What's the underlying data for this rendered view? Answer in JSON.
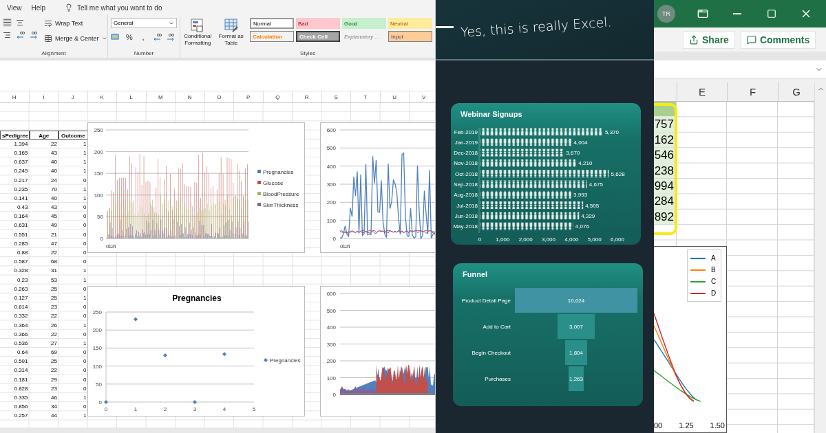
{
  "excel_left": {
    "menu": [
      {
        "label": "View"
      },
      {
        "label": "Help"
      }
    ],
    "tell_me": "Tell me what you want to do",
    "alignment": {
      "wrap_text": "Wrap Text",
      "merge": "Merge & Center",
      "label": "Alignment"
    },
    "number": {
      "format": "General",
      "percent": "%",
      "comma": ",",
      "label": "Number"
    },
    "styles": {
      "conditional": [
        "Conditional",
        "Formatting"
      ],
      "format_table": [
        "Format as",
        "Table"
      ],
      "label": "Styles",
      "cells": [
        {
          "label": "Normal",
          "kind": "normal"
        },
        {
          "label": "Bad",
          "kind": "bad"
        },
        {
          "label": "Good",
          "kind": "good"
        },
        {
          "label": "Neutral",
          "kind": "neutral"
        },
        {
          "label": "Calculation",
          "kind": "calculation"
        },
        {
          "label": "Check Cell",
          "kind": "check"
        },
        {
          "label": "Explanatory ...",
          "kind": "explanatory"
        },
        {
          "label": "Input",
          "kind": "input"
        }
      ]
    },
    "columns": [
      "H",
      "I",
      "J",
      "K",
      "L",
      "M",
      "N",
      "O",
      "P",
      "Q",
      "R",
      "S",
      "T",
      "U",
      "V"
    ],
    "table": {
      "columns": [
        "sPedigree",
        "Age",
        "Outcome"
      ],
      "rows": [
        [
          "1.394",
          "22",
          "1"
        ],
        [
          "0.165",
          "43",
          "1"
        ],
        [
          "0.637",
          "40",
          "1"
        ],
        [
          "0.245",
          "40",
          "1"
        ],
        [
          "0.217",
          "24",
          "0"
        ],
        [
          "0.235",
          "70",
          "1"
        ],
        [
          "0.141",
          "40",
          "1"
        ],
        [
          "0.43",
          "43",
          "0"
        ],
        [
          "0.164",
          "45",
          "0"
        ],
        [
          "0.631",
          "49",
          "0"
        ],
        [
          "0.551",
          "21",
          "0"
        ],
        [
          "0.285",
          "47",
          "0"
        ],
        [
          "0.88",
          "22",
          "0"
        ],
        [
          "0.587",
          "68",
          "0"
        ],
        [
          "0.328",
          "31",
          "1"
        ],
        [
          "0.23",
          "53",
          "1"
        ],
        [
          "0.263",
          "25",
          "0"
        ],
        [
          "0.127",
          "25",
          "1"
        ],
        [
          "0.614",
          "23",
          "0"
        ],
        [
          "0.332",
          "22",
          "0"
        ],
        [
          "0.364",
          "26",
          "1"
        ],
        [
          "0.366",
          "22",
          "0"
        ],
        [
          "0.536",
          "27",
          "1"
        ],
        [
          "0.64",
          "69",
          "0"
        ],
        [
          "0.591",
          "25",
          "0"
        ],
        [
          "0.314",
          "22",
          "0"
        ],
        [
          "0.181",
          "29",
          "0"
        ],
        [
          "0.828",
          "23",
          "0"
        ],
        [
          "0.335",
          "46",
          "1"
        ],
        [
          "0.856",
          "34",
          "0"
        ],
        [
          "0.257",
          "44",
          "1"
        ]
      ]
    },
    "bar_chart": {
      "y_ticks": [
        "250",
        "200",
        "150",
        "100",
        "50",
        "0"
      ],
      "x_tick": "0124",
      "legend": [
        {
          "label": "Pregnancies",
          "color": "#4f81bd"
        },
        {
          "label": "Glucose",
          "color": "#c0504d"
        },
        {
          "label": "BloodPressure",
          "color": "#9bbb59"
        },
        {
          "label": "SkinThickness",
          "color": "#8064a2"
        }
      ]
    },
    "line_chart": {
      "y_ticks": [
        "600",
        "500",
        "400",
        "300",
        "200",
        "100",
        "0"
      ],
      "x_tick": "0124"
    },
    "scatter_chart": {
      "chart_data": {
        "type": "scatter",
        "title": "Pregnancies",
        "x": [
          0,
          1,
          2,
          3,
          4
        ],
        "series": [
          {
            "name": "Pregnancies",
            "color": "#4f81bd",
            "values": [
              0,
              230,
              130,
              0,
              133
            ]
          }
        ],
        "xlim": [
          0,
          5
        ],
        "ylim": [
          0,
          250
        ],
        "xticks": [
          0,
          1,
          2,
          3,
          4,
          5
        ],
        "yticks": [
          0,
          50,
          100,
          150,
          200,
          250
        ],
        "grid": true
      }
    },
    "area_chart": {
      "y_ticks": [
        "600",
        "500",
        "400",
        "300",
        "200",
        "100",
        "0"
      ]
    }
  },
  "dashboard": {
    "headline": "Yes, this is really Excel.",
    "webinar": {
      "title": "Webinar Signups",
      "chart_data": {
        "type": "bar",
        "orientation": "horizontal",
        "categories": [
          "Feb-2019",
          "Jan-2019",
          "Dec-2018",
          "Nov-2018",
          "Oct-2018",
          "Sep-2018",
          "Aug-2018",
          "Jul-2018",
          "Jun-2018",
          "May-2018"
        ],
        "series": [
          {
            "color": "#e3efec",
            "values": [
              5370,
              4004,
              3670,
              4210,
              5628,
              4675,
              3993,
              4505,
              4329,
              4076
            ]
          }
        ],
        "xlim": [
          0,
          6000
        ],
        "xticks": [
          {
            "value": 0,
            "label": "0"
          },
          {
            "value": 1000,
            "label": "1,000"
          },
          {
            "value": 2000,
            "label": "2,000"
          },
          {
            "value": 3000,
            "label": "3,000"
          },
          {
            "value": 4000,
            "label": "4,000"
          },
          {
            "value": 5000,
            "label": "5,000"
          },
          {
            "value": 6000,
            "label": "6,000"
          }
        ],
        "value_labels": [
          "5,370",
          "4,004",
          "3,670",
          "4,210",
          "5,628",
          "4,675",
          "3,993",
          "4,505",
          "4,329",
          "4,076"
        ]
      }
    },
    "funnel": {
      "title": "Funnel",
      "stages": [
        {
          "label": "Product Detail Page",
          "value": "10,024"
        },
        {
          "label": "Add to Cart",
          "value": "3,007"
        },
        {
          "label": "Begin Checkout",
          "value": "1,804"
        },
        {
          "label": "Purchases",
          "value": "1,263"
        }
      ]
    }
  },
  "excel_right": {
    "avatar": "TR",
    "share": "Share",
    "comments": "Comments",
    "columns": [
      "E",
      "F",
      "G"
    ],
    "cells": [
      "757",
      "162",
      "546",
      "238",
      "994",
      "284",
      "892"
    ],
    "legend": [
      {
        "label": "A",
        "color": "#1f77b4"
      },
      {
        "label": "B",
        "color": "#ff7f0e"
      },
      {
        "label": "C",
        "color": "#2ca02c"
      },
      {
        "label": "D",
        "color": "#d62728"
      }
    ],
    "x_ticks": [
      "00",
      "1.25",
      "1.50"
    ]
  }
}
